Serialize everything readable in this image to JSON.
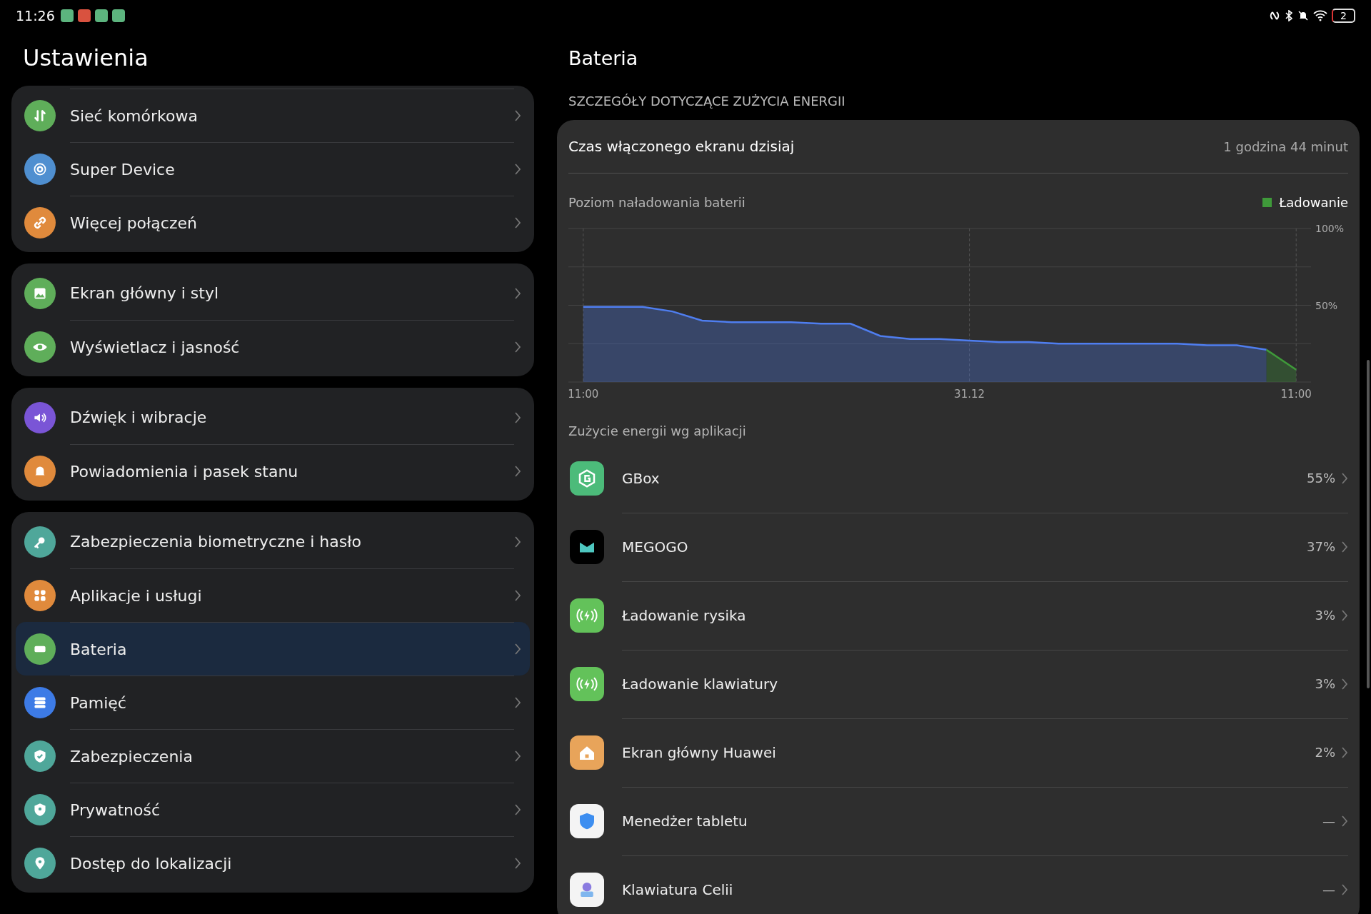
{
  "status_bar": {
    "time": "11:26",
    "notifications": [
      {
        "color": "#5cb47e"
      },
      {
        "color": "#d9523f"
      },
      {
        "color": "#5cb47e"
      },
      {
        "color": "#5cb47e"
      }
    ],
    "battery": "2"
  },
  "sidebar": {
    "title": "Ustawienia",
    "groups": [
      {
        "items": [
          {
            "label": "Sieć komórkowa",
            "kind": "network",
            "color": "#5fae5a",
            "selected": false
          },
          {
            "label": "Super Device",
            "kind": "device",
            "color": "#4f8fd0",
            "selected": false
          },
          {
            "label": "Więcej połączeń",
            "kind": "link",
            "color": "#e08a3c",
            "selected": false
          }
        ]
      },
      {
        "items": [
          {
            "label": "Ekran główny i styl",
            "kind": "image",
            "color": "#5fae5a",
            "selected": false
          },
          {
            "label": "Wyświetlacz i jasność",
            "kind": "eye",
            "color": "#5fae5a",
            "selected": false
          }
        ]
      },
      {
        "items": [
          {
            "label": "Dźwięk i wibracje",
            "kind": "sound",
            "color": "#7a55d6",
            "selected": false
          },
          {
            "label": "Powiadomienia i pasek stanu",
            "kind": "bell",
            "color": "#e08a3c",
            "selected": false
          }
        ]
      },
      {
        "items": [
          {
            "label": "Zabezpieczenia biometryczne i hasło",
            "kind": "key",
            "color": "#4fa79a",
            "selected": false
          },
          {
            "label": "Aplikacje i usługi",
            "kind": "apps",
            "color": "#e08a3c",
            "selected": false
          },
          {
            "label": "Bateria",
            "kind": "battery",
            "color": "#5fae5a",
            "selected": true
          },
          {
            "label": "Pamięć",
            "kind": "storage",
            "color": "#3d7be6",
            "selected": false
          },
          {
            "label": "Zabezpieczenia",
            "kind": "shield",
            "color": "#4fa79a",
            "selected": false
          },
          {
            "label": "Prywatność",
            "kind": "privacy",
            "color": "#4fa79a",
            "selected": false
          },
          {
            "label": "Dostęp do lokalizacji",
            "kind": "location",
            "color": "#4fa79a",
            "selected": false
          }
        ]
      }
    ]
  },
  "detail": {
    "title": "Bateria",
    "section": "SZCZEGÓŁY DOTYCZĄCE ZUŻYCIA ENERGII",
    "screen_time": {
      "label": "Czas włączonego ekranu dzisiaj",
      "value": "1 godzina 44 minut"
    },
    "chart_data": {
      "type": "area",
      "title": "Poziom naładowania baterii",
      "categories": [
        "11:00",
        null,
        null,
        null,
        null,
        null,
        null,
        null,
        null,
        null,
        null,
        null,
        null,
        "31.12",
        null,
        null,
        null,
        null,
        null,
        null,
        null,
        null,
        null,
        null,
        "11:00"
      ],
      "series": [
        {
          "color": "#4f7ef0",
          "values": [
            49,
            49,
            49,
            46,
            40,
            39,
            39,
            39,
            38,
            38,
            30,
            28,
            28,
            27,
            26,
            26,
            25,
            25,
            25,
            25,
            25,
            24,
            24,
            21,
            null
          ]
        },
        {
          "name": "Ładowanie",
          "color": "#3f9a3a",
          "values": [
            null,
            null,
            null,
            null,
            null,
            null,
            null,
            null,
            null,
            null,
            null,
            null,
            null,
            null,
            null,
            null,
            null,
            null,
            null,
            null,
            null,
            null,
            null,
            21,
            8
          ]
        }
      ],
      "ylim": [
        0,
        100
      ],
      "grid": true,
      "yticks": [
        {
          "value": 50,
          "label": "50%"
        },
        {
          "value": 100,
          "label": "100%"
        }
      ]
    },
    "apps_title": "Zużycie energii wg aplikacji",
    "apps": [
      {
        "name": "GBox",
        "usage": "55%",
        "kind": "gbox"
      },
      {
        "name": "MEGOGO",
        "usage": "37%",
        "kind": "megogo"
      },
      {
        "name": "Ładowanie rysika",
        "usage": "3%",
        "kind": "charge"
      },
      {
        "name": "Ładowanie klawiatury",
        "usage": "3%",
        "kind": "charge"
      },
      {
        "name": "Ekran główny Huawei",
        "usage": "2%",
        "kind": "home"
      },
      {
        "name": "Menedżer tabletu",
        "usage": "—",
        "kind": "manager"
      },
      {
        "name": "Klawiatura Celii",
        "usage": "—",
        "kind": "keyboard"
      }
    ]
  }
}
